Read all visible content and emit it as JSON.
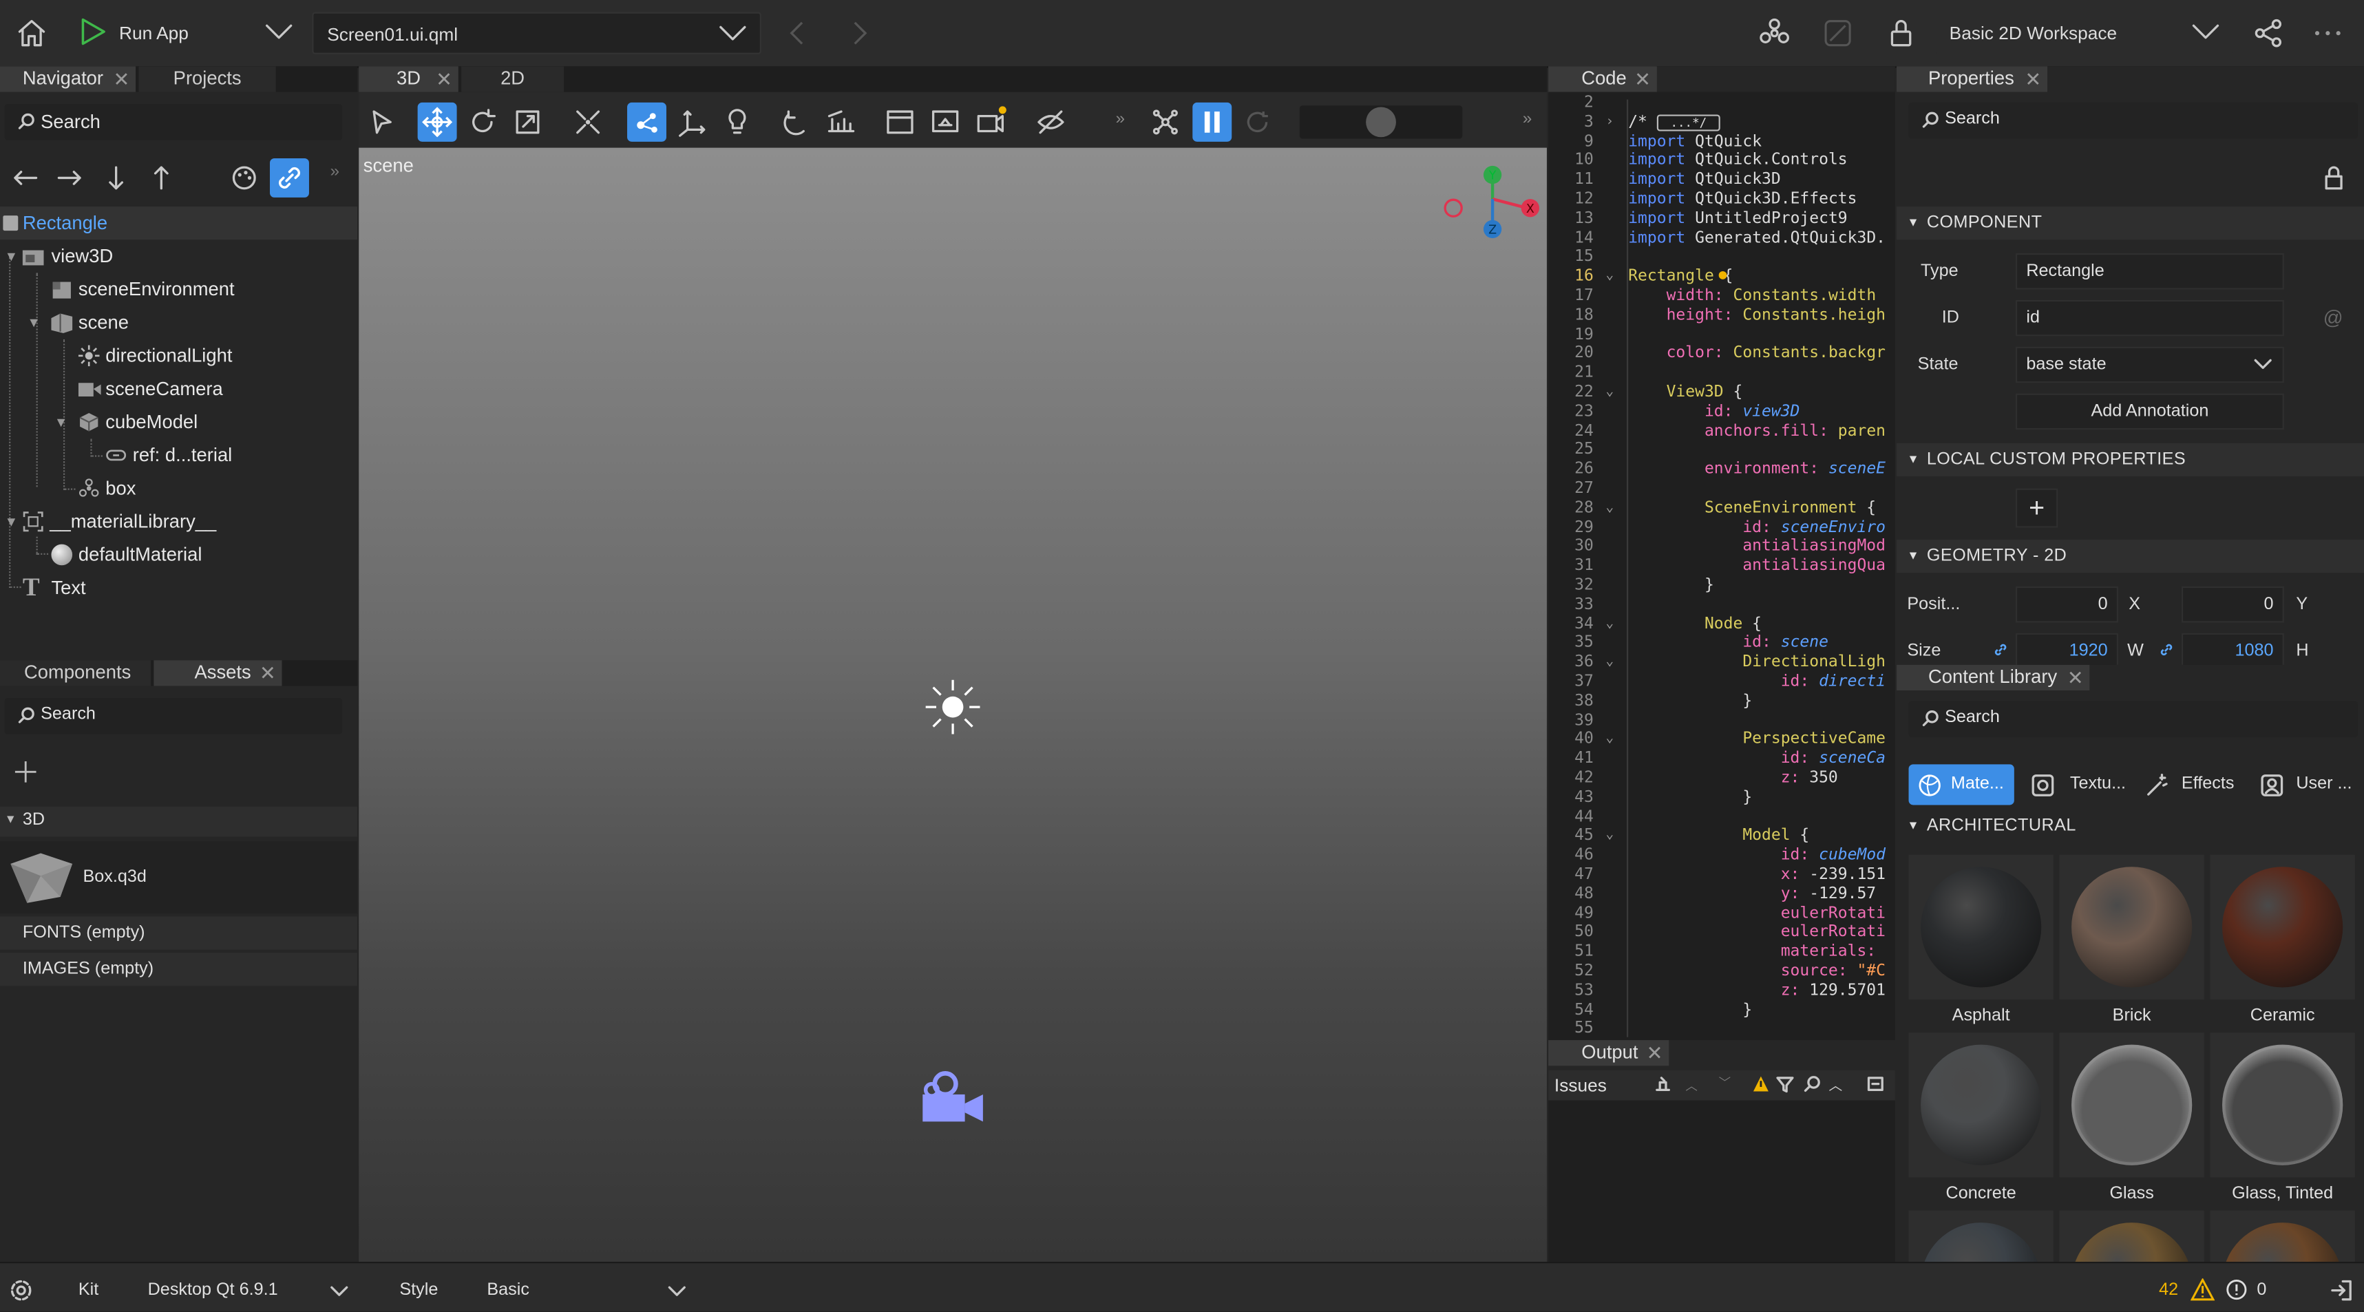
{
  "topbar": {
    "run_label": "Run App",
    "file": "Screen01.ui.qml",
    "workspace": "Basic 2D Workspace"
  },
  "navigator": {
    "tabs": [
      "Navigator",
      "Projects"
    ],
    "search_placeholder": "Search",
    "tree": [
      {
        "label": "Rectangle",
        "icon": "rectangle-icon",
        "selected": true
      },
      {
        "label": "view3D",
        "icon": "view3d-icon"
      },
      {
        "label": "sceneEnvironment",
        "icon": "scene-environment-icon"
      },
      {
        "label": "scene",
        "icon": "scene-node-icon"
      },
      {
        "label": "directionalLight",
        "icon": "light-icon"
      },
      {
        "label": "sceneCamera",
        "icon": "camera-icon"
      },
      {
        "label": "cubeModel",
        "icon": "model-icon"
      },
      {
        "label": "ref: d...terial",
        "icon": "reference-icon"
      },
      {
        "label": "box",
        "icon": "box-icon"
      },
      {
        "label": "__materialLibrary__",
        "icon": "material-library-icon"
      },
      {
        "label": "defaultMaterial",
        "icon": "material-icon"
      },
      {
        "label": "Text",
        "icon": "text-icon"
      }
    ]
  },
  "assets": {
    "tabs": [
      "Components",
      "Assets"
    ],
    "search_placeholder": "Search",
    "section_3d": "3D",
    "box_file": "Box.q3d",
    "fonts": "FONTS (empty)",
    "images": "IMAGES (empty)"
  },
  "viewport": {
    "tabs": [
      "3D",
      "2D"
    ],
    "scene_label": "scene",
    "gizmo": {
      "x": "X",
      "y": "Y",
      "z": "Z"
    }
  },
  "code": {
    "tab": "Code",
    "lines": [
      {
        "n": "2",
        "t": []
      },
      {
        "n": "3",
        "t": [
          [
            "nm",
            "/* "
          ],
          [
            "box",
            "...*/"
          ]
        ]
      },
      {
        "n": "9",
        "t": [
          [
            "kw",
            "import"
          ],
          [
            "nm",
            " QtQuick"
          ]
        ]
      },
      {
        "n": "10",
        "t": [
          [
            "kw",
            "import"
          ],
          [
            "nm",
            " QtQuick.Controls"
          ]
        ]
      },
      {
        "n": "11",
        "t": [
          [
            "kw",
            "import"
          ],
          [
            "nm",
            " QtQuick3D"
          ]
        ]
      },
      {
        "n": "12",
        "t": [
          [
            "kw",
            "import"
          ],
          [
            "nm",
            " QtQuick3D.Effects"
          ]
        ]
      },
      {
        "n": "13",
        "t": [
          [
            "kw",
            "import"
          ],
          [
            "nm",
            " UntitledProject9"
          ]
        ]
      },
      {
        "n": "14",
        "t": [
          [
            "kw",
            "import"
          ],
          [
            "nm",
            " Generated.QtQuick3D."
          ]
        ]
      },
      {
        "n": "15",
        "t": []
      },
      {
        "n": "16",
        "t": [
          [
            "tp",
            "Rectangle"
          ],
          [
            "nm",
            " {"
          ]
        ],
        "cur": true
      },
      {
        "n": "17",
        "t": [
          [
            "pr",
            "    width: "
          ],
          [
            "tp",
            "Constants.width"
          ]
        ]
      },
      {
        "n": "18",
        "t": [
          [
            "pr",
            "    height: "
          ],
          [
            "tp",
            "Constants.heigh"
          ]
        ]
      },
      {
        "n": "19",
        "t": []
      },
      {
        "n": "20",
        "t": [
          [
            "pr",
            "    color: "
          ],
          [
            "tp",
            "Constants.backgr"
          ]
        ]
      },
      {
        "n": "21",
        "t": []
      },
      {
        "n": "22",
        "t": [
          [
            "tp",
            "    View3D"
          ],
          [
            "nm",
            " {"
          ]
        ]
      },
      {
        "n": "23",
        "t": [
          [
            "pr",
            "        id: "
          ],
          [
            "it",
            "view3D"
          ]
        ]
      },
      {
        "n": "24",
        "t": [
          [
            "pr",
            "        anchors.fill: "
          ],
          [
            "tp",
            "paren"
          ]
        ]
      },
      {
        "n": "25",
        "t": []
      },
      {
        "n": "26",
        "t": [
          [
            "pr",
            "        environment: "
          ],
          [
            "it",
            "sceneE"
          ]
        ]
      },
      {
        "n": "27",
        "t": []
      },
      {
        "n": "28",
        "t": [
          [
            "tp",
            "        SceneEnvironment"
          ],
          [
            "nm",
            " {"
          ]
        ]
      },
      {
        "n": "29",
        "t": [
          [
            "pr",
            "            id: "
          ],
          [
            "it",
            "sceneEnviro"
          ]
        ]
      },
      {
        "n": "30",
        "t": [
          [
            "pr",
            "            antialiasingMod"
          ]
        ]
      },
      {
        "n": "31",
        "t": [
          [
            "pr",
            "            antialiasingQua"
          ]
        ]
      },
      {
        "n": "32",
        "t": [
          [
            "nm",
            "        }"
          ]
        ]
      },
      {
        "n": "33",
        "t": []
      },
      {
        "n": "34",
        "t": [
          [
            "tp",
            "        Node"
          ],
          [
            "nm",
            " {"
          ]
        ]
      },
      {
        "n": "35",
        "t": [
          [
            "pr",
            "            id: "
          ],
          [
            "it",
            "scene"
          ]
        ]
      },
      {
        "n": "36",
        "t": [
          [
            "tp",
            "            DirectionalLigh"
          ]
        ]
      },
      {
        "n": "37",
        "t": [
          [
            "pr",
            "                id: "
          ],
          [
            "it",
            "directi"
          ]
        ]
      },
      {
        "n": "38",
        "t": [
          [
            "nm",
            "            }"
          ]
        ]
      },
      {
        "n": "39",
        "t": []
      },
      {
        "n": "40",
        "t": [
          [
            "tp",
            "            PerspectiveCame"
          ]
        ]
      },
      {
        "n": "41",
        "t": [
          [
            "pr",
            "                id: "
          ],
          [
            "it",
            "sceneCa"
          ]
        ]
      },
      {
        "n": "42",
        "t": [
          [
            "pr",
            "                z: "
          ],
          [
            "nm",
            "350"
          ]
        ]
      },
      {
        "n": "43",
        "t": [
          [
            "nm",
            "            }"
          ]
        ]
      },
      {
        "n": "44",
        "t": []
      },
      {
        "n": "45",
        "t": [
          [
            "tp",
            "            Model"
          ],
          [
            "nm",
            " {"
          ]
        ]
      },
      {
        "n": "46",
        "t": [
          [
            "pr",
            "                id: "
          ],
          [
            "it",
            "cubeMod"
          ]
        ]
      },
      {
        "n": "47",
        "t": [
          [
            "pr",
            "                x: "
          ],
          [
            "nm",
            "-239.151"
          ]
        ]
      },
      {
        "n": "48",
        "t": [
          [
            "pr",
            "                y: "
          ],
          [
            "nm",
            "-129.57"
          ]
        ]
      },
      {
        "n": "49",
        "t": [
          [
            "pr",
            "                eulerRotati"
          ]
        ]
      },
      {
        "n": "50",
        "t": [
          [
            "pr",
            "                eulerRotati"
          ]
        ]
      },
      {
        "n": "51",
        "t": [
          [
            "pr",
            "                materials: "
          ]
        ]
      },
      {
        "n": "52",
        "t": [
          [
            "pr",
            "                source: "
          ],
          [
            "st",
            "\"#C"
          ]
        ]
      },
      {
        "n": "53",
        "t": [
          [
            "pr",
            "                z: "
          ],
          [
            "nm",
            "129.5701"
          ]
        ]
      },
      {
        "n": "54",
        "t": [
          [
            "nm",
            "            }"
          ]
        ]
      },
      {
        "n": "55",
        "t": []
      }
    ]
  },
  "output": {
    "tab": "Output",
    "issues": "Issues"
  },
  "properties": {
    "tab": "Properties",
    "search_placeholder": "Search",
    "component_header": "COMPONENT",
    "type_label": "Type",
    "type_value": "Rectangle",
    "id_label": "ID",
    "id_value": "id",
    "state_label": "State",
    "state_value": "base state",
    "add_annotation": "Add Annotation",
    "local_header": "LOCAL CUSTOM PROPERTIES",
    "add_symbol": "+",
    "geometry_header": "GEOMETRY - 2D",
    "position_label": "Posit...",
    "pos_x": "0",
    "pos_x_label": "X",
    "pos_y": "0",
    "pos_y_label": "Y",
    "size_label": "Size",
    "width": "1920",
    "width_label": "W",
    "height": "1080",
    "height_label": "H"
  },
  "content_library": {
    "tab": "Content Library",
    "search_placeholder": "Search",
    "tabs": [
      "Mate...",
      "Textu...",
      "Effects",
      "User ..."
    ],
    "section": "ARCHITECTURAL",
    "materials": [
      {
        "name": "Asphalt",
        "color": "#2b2d2f"
      },
      {
        "name": "Brick",
        "color": "#6e5a4e"
      },
      {
        "name": "Ceramic",
        "color": "#5a2a1c"
      },
      {
        "name": "Concrete",
        "color": "#4a4c4e"
      },
      {
        "name": "Glass",
        "color": "#5c5c5c"
      },
      {
        "name": "Glass, Tinted",
        "color": "#474747"
      },
      {
        "name": "",
        "color": "#3c4248"
      },
      {
        "name": "",
        "color": "#6d5430"
      },
      {
        "name": "",
        "color": "#6a4628"
      }
    ]
  },
  "statusbar": {
    "kit_label": "Kit",
    "kit_value": "Desktop Qt 6.9.1",
    "style_label": "Style",
    "style_value": "Basic",
    "warnings": "42",
    "errors": "0"
  },
  "colors": {
    "accent": "#3d8ee6",
    "selection_text": "#5aa7ff",
    "warning": "#f0b400"
  }
}
